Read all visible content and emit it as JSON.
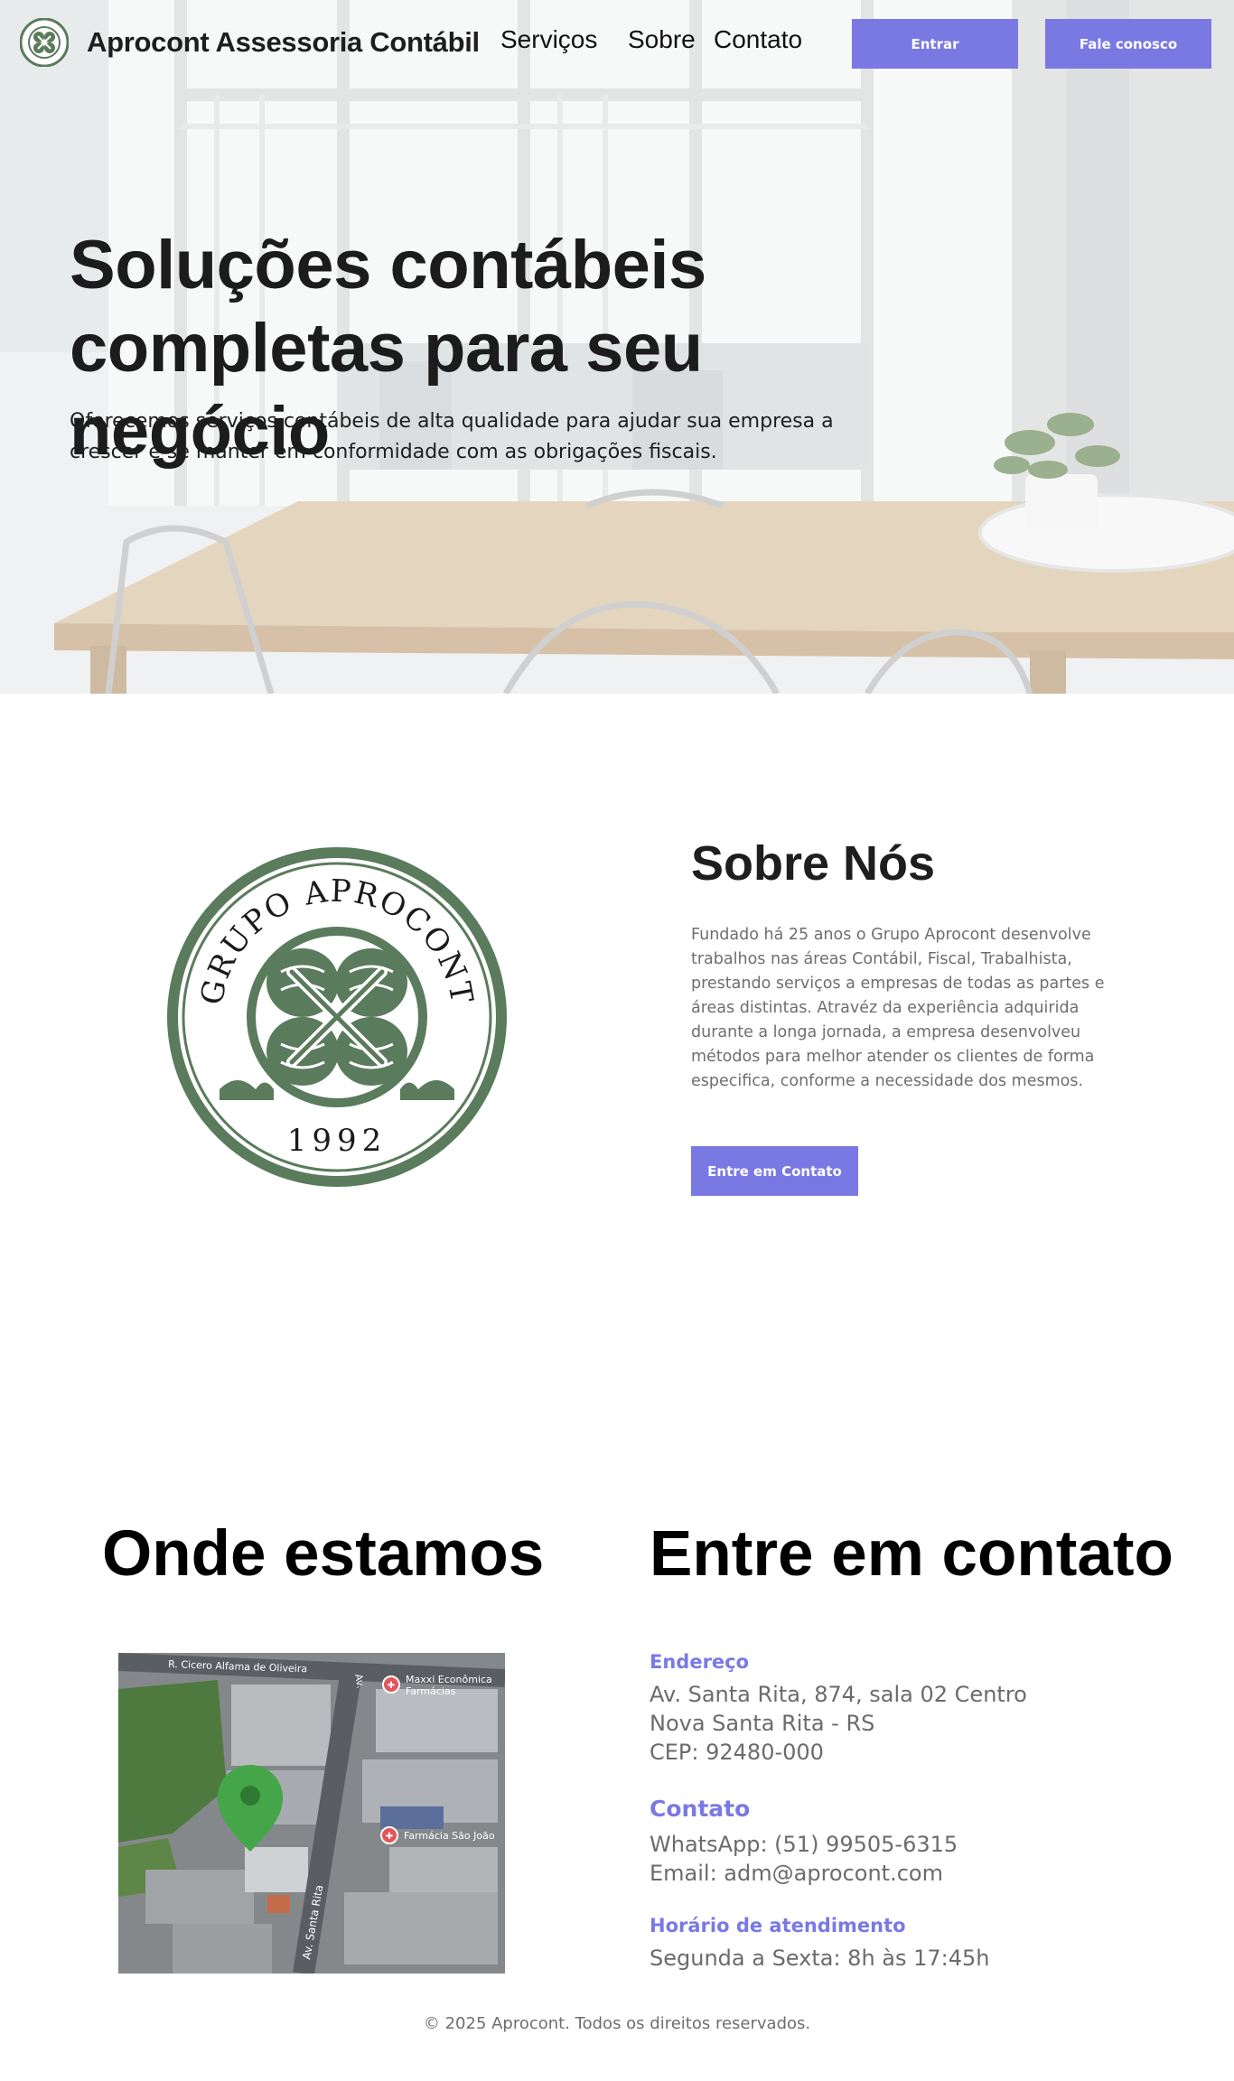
{
  "brand": {
    "name": "Aprocont Assessoria Contábil",
    "logo_icon": "aprocont-seal-icon"
  },
  "nav": {
    "links": [
      "Serviços",
      "Sobre",
      "Contato"
    ],
    "login_label": "Entrar",
    "cta_label": "Fale conosco"
  },
  "hero": {
    "title_line1": "Soluções contábeis",
    "title_line2": "completas para seu negócio",
    "subtitle": "Oferecemos serviços contábeis de alta qualidade para ajudar sua empresa a crescer e se manter em conformidade com as obrigações fiscais."
  },
  "about": {
    "seal": {
      "top_text": "GRUPO APROCONT",
      "year": "1992",
      "icon": "clover-seal-icon"
    },
    "title": "Sobre Nós",
    "text": "Fundado há 25 anos o Grupo Aprocont desenvolve trabalhos nas áreas Contábil, Fiscal, Trabalhista, prestando serviços a empresas de todas as partes e áreas distintas. Atravéz da experiência adquirida durante a longa jornada, a empresa desenvolveu métodos para melhor atender os clientes de forma especifica, conforme a necessidade dos mesmos.",
    "button_label": "Entre em Contato"
  },
  "location": {
    "title": "Onde estamos",
    "map": {
      "street_top": "R. Cicero Alfama de Oliveira",
      "street_side": "Av. Santa Rita",
      "street_side_short": "Av.",
      "poi1_line1": "Maxxi Econômica",
      "poi1_line2": "Farmácias",
      "poi2": "Farmácia São João",
      "pin_icon": "map-pin-icon"
    }
  },
  "contact": {
    "title": "Entre em contato",
    "address_label": "Endereço",
    "address_lines": [
      "Av. Santa Rita, 874, sala 02 Centro",
      "Nova Santa Rita - RS",
      "CEP: 92480-000"
    ],
    "contact_label": "Contato",
    "whatsapp": "WhatsApp: (51) 99505-6315",
    "email": "Email: adm@aprocont.com",
    "hours_label": "Horário de atendimento",
    "hours": "Segunda a Sexta: 8h às 17:45h"
  },
  "footer": {
    "text": "© 2025 Aprocont. Todos os direitos reservados."
  },
  "colors": {
    "accent": "#7a79e4",
    "seal_green": "#5a7b5c",
    "map_pin": "#44a649",
    "text_muted": "#6e6e6e"
  }
}
